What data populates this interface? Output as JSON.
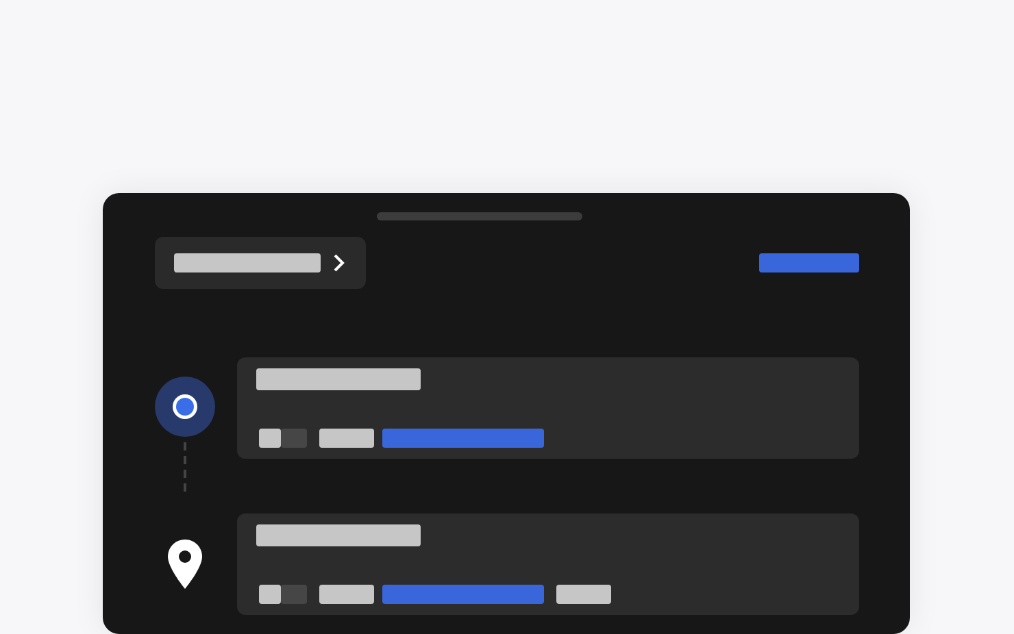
{
  "header": {
    "crumb": {
      "kind": "placeholder"
    },
    "action": {
      "kind": "accent"
    }
  },
  "stops": [
    {
      "kind": "origin",
      "title": {
        "kind": "light"
      },
      "bars": [
        {
          "kind": "swatch"
        },
        {
          "kind": "shade"
        },
        {
          "kind": "tag"
        },
        {
          "kind": "link"
        }
      ]
    },
    {
      "kind": "destination",
      "title": {
        "kind": "light"
      },
      "bars": [
        {
          "kind": "swatch"
        },
        {
          "kind": "shade"
        },
        {
          "kind": "tag"
        },
        {
          "kind": "link"
        },
        {
          "kind": "tag"
        }
      ]
    }
  ]
}
